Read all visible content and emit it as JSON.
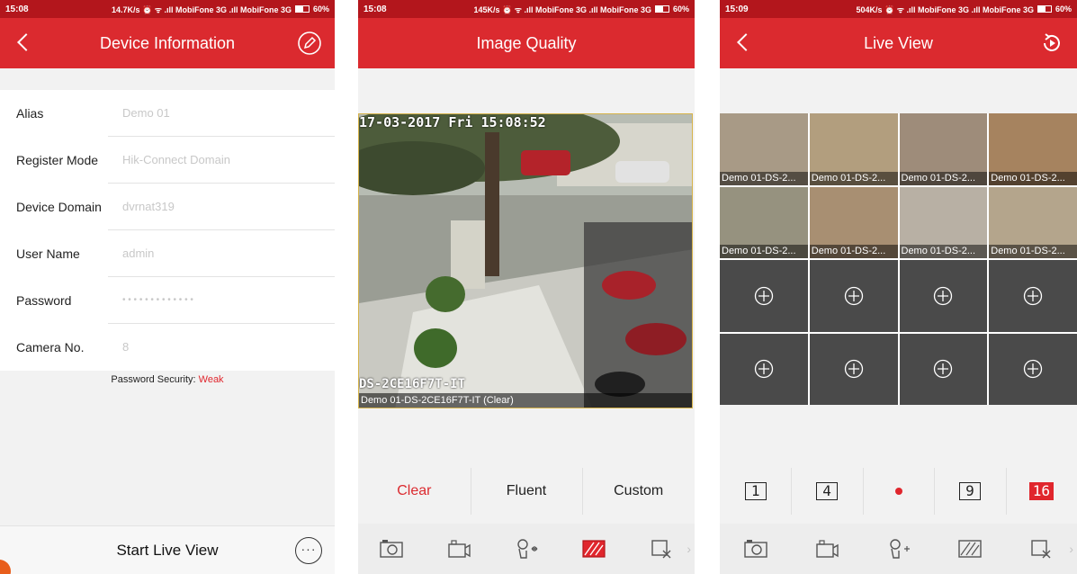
{
  "screens": [
    {
      "status": {
        "time": "15:08",
        "info": "14.7K/s ⏰ ᯤ .ıll MobiFone 3G .ıll MobiFone 3G",
        "battery": "60%"
      },
      "title": "Device Information",
      "fields": [
        {
          "label": "Alias",
          "value": "Demo 01"
        },
        {
          "label": "Register Mode",
          "value": "Hik-Connect Domain"
        },
        {
          "label": "Device Domain",
          "value": "dvrnat319"
        },
        {
          "label": "User Name",
          "value": "admin"
        },
        {
          "label": "Password",
          "value": "• • • • • • • • • • • • •"
        },
        {
          "label": "Camera No.",
          "value": "8"
        }
      ],
      "password_security_label": "Password Security:",
      "password_security_value": "Weak",
      "start_live_view": "Start Live View",
      "more_label": "···"
    },
    {
      "status": {
        "time": "15:08",
        "info": "145K/s ⏰ ᯤ .ıll MobiFone 3G .ıll MobiFone 3G",
        "battery": "60%"
      },
      "title": "Image Quality",
      "osd_date": "17-03-2017 Fri 15:08:52",
      "osd_name": "DS-2CE16F7T-IT",
      "caption": "Demo 01-DS-2CE16F7T-IT (Clear)",
      "options": [
        "Clear",
        "Fluent",
        "Custom"
      ],
      "active_option": "Clear"
    },
    {
      "status": {
        "time": "15:09",
        "info": "504K/s ⏰ ᯤ .ıll MobiFone 3G .ıll MobiFone 3G",
        "battery": "60%"
      },
      "title": "Live View",
      "cell_captions": [
        "Demo 01-DS-2...",
        "Demo 01-DS-2...",
        "Demo 01-DS-2...",
        "Demo 01-DS-2...",
        "Demo 01-DS-2...",
        "Demo 01-DS-2...",
        "Demo 01-DS-2...",
        "Demo 01-DS-2..."
      ],
      "layouts": [
        "1",
        "4",
        "9",
        "16"
      ],
      "active_layout": "16"
    }
  ],
  "icons": {
    "toolbar": [
      "camera-icon",
      "record-icon",
      "ptz-icon",
      "quality-icon",
      "close-window-icon"
    ],
    "edit": "edit-icon",
    "playback": "playback-icon",
    "add": "add-camera-icon"
  },
  "colors": {
    "header": "#db2a2f",
    "status": "#b3161c",
    "accent": "#e0262d"
  }
}
